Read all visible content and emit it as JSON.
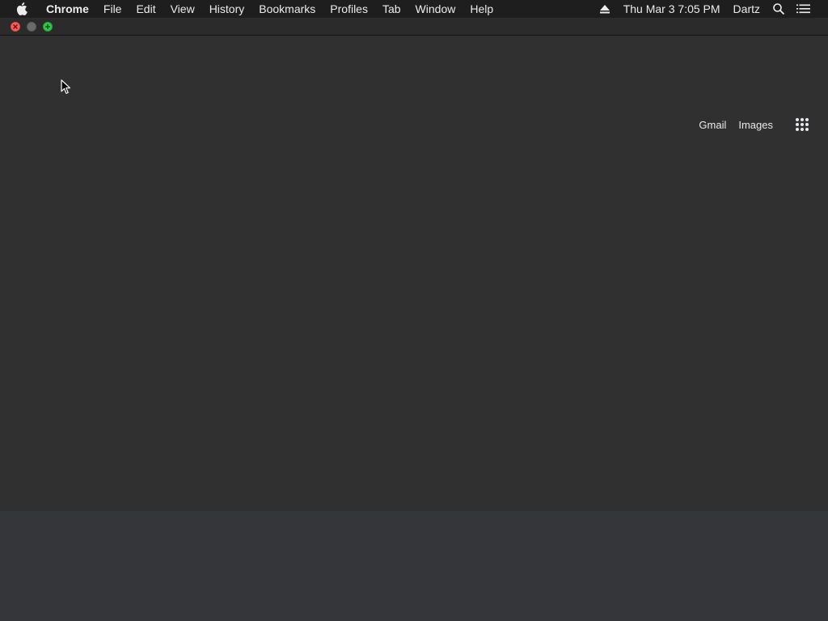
{
  "menubar": {
    "apple_icon": "apple-icon",
    "items": [
      {
        "label": "Chrome"
      },
      {
        "label": "File"
      },
      {
        "label": "Edit"
      },
      {
        "label": "View"
      },
      {
        "label": "History"
      },
      {
        "label": "Bookmarks"
      },
      {
        "label": "Profiles"
      },
      {
        "label": "Tab"
      },
      {
        "label": "Window"
      },
      {
        "label": "Help"
      }
    ],
    "status": {
      "eject_icon": "eject-icon",
      "datetime": "Thu Mar 3  7:05 PM",
      "user": "Dartz",
      "search_icon": "spotlight-search-icon",
      "notification_icon": "notification-center-icon"
    }
  },
  "window": {
    "traffic_lights": [
      "close",
      "minimize",
      "zoom"
    ]
  },
  "google": {
    "gmail_label": "Gmail",
    "images_label": "Images",
    "apps_icon": "google-apps-grid-icon"
  },
  "colors": {
    "menubar_bg": "#1e1e1e",
    "content_bg": "#303030",
    "bottom_bg": "#35363a",
    "text": "#e8eaed"
  }
}
